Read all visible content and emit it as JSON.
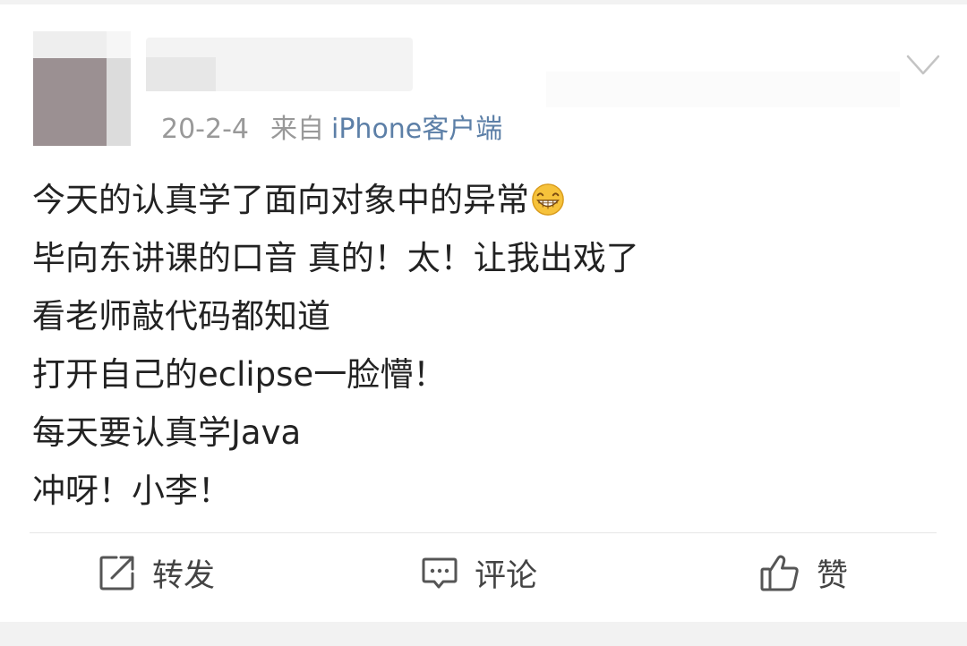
{
  "post": {
    "date": "20-2-4",
    "source_prefix": "来自",
    "source_app": "iPhone客户端",
    "lines": [
      "今天的认真学了面向对象中的异常",
      "毕向东讲课的口音 真的！太！让我出戏了",
      "看老师敲代码都知道",
      "打开自己的eclipse一脸懵！",
      "每天要认真学Java",
      "冲呀！小李！"
    ],
    "emoji": "grin-emoji-icon"
  },
  "actions": {
    "repost_label": "转发",
    "comment_label": "评论",
    "like_label": "赞"
  },
  "icons": {
    "menu": "chevron-down-icon",
    "repost": "repost-icon",
    "comment": "comment-icon",
    "like": "thumbs-up-icon"
  },
  "colors": {
    "meta_text": "#999999",
    "source_link": "#5c7fa7",
    "body_text": "#222222",
    "action_text": "#444444",
    "background": "#f2f2f2"
  }
}
